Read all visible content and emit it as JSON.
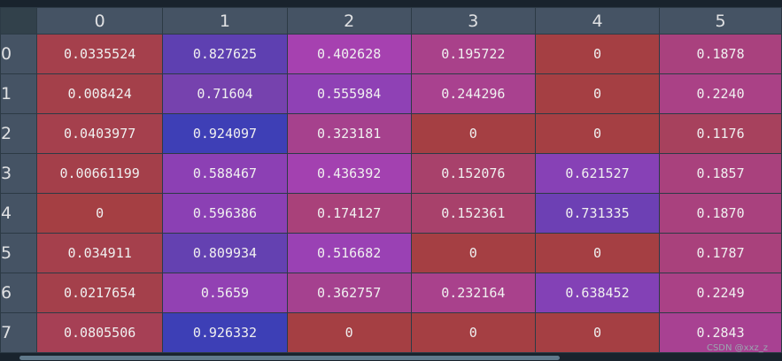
{
  "table": {
    "columns": [
      "0",
      "1",
      "2",
      "3",
      "4",
      "5"
    ],
    "rows": [
      {
        "index": "0",
        "cells": [
          {
            "text": "0.0335524",
            "color": "#a5404c"
          },
          {
            "text": "0.827625",
            "color": "#5e40b1"
          },
          {
            "text": "0.402628",
            "color": "#a641b0"
          },
          {
            "text": "0.195722",
            "color": "#a9418a"
          },
          {
            "text": "0",
            "color": "#a53f43"
          },
          {
            "text": "0.1878",
            "color": "#a9417e"
          }
        ]
      },
      {
        "index": "1",
        "cells": [
          {
            "text": "0.008424",
            "color": "#a4404a"
          },
          {
            "text": "0.71604",
            "color": "#7642ae"
          },
          {
            "text": "0.555984",
            "color": "#8f41b5"
          },
          {
            "text": "0.244296",
            "color": "#a9418f"
          },
          {
            "text": "0",
            "color": "#a53f43"
          },
          {
            "text": "0.2240",
            "color": "#aa4186"
          }
        ]
      },
      {
        "index": "2",
        "cells": [
          {
            "text": "0.0403977",
            "color": "#a5404d"
          },
          {
            "text": "0.924097",
            "color": "#3e3fb6"
          },
          {
            "text": "0.323181",
            "color": "#a6418d"
          },
          {
            "text": "0",
            "color": "#a53f43"
          },
          {
            "text": "0",
            "color": "#a53f43"
          },
          {
            "text": "0.1176",
            "color": "#a7415d"
          }
        ]
      },
      {
        "index": "3",
        "cells": [
          {
            "text": "0.00661199",
            "color": "#a43f4a"
          },
          {
            "text": "0.588467",
            "color": "#8c40b4"
          },
          {
            "text": "0.436392",
            "color": "#a341b0"
          },
          {
            "text": "0.152076",
            "color": "#a8416b"
          },
          {
            "text": "0.621527",
            "color": "#8741b6"
          },
          {
            "text": "0.1857",
            "color": "#a9417d"
          }
        ]
      },
      {
        "index": "4",
        "cells": [
          {
            "text": "0",
            "color": "#a53f43"
          },
          {
            "text": "0.596386",
            "color": "#8b40b4"
          },
          {
            "text": "0.174127",
            "color": "#a9417a"
          },
          {
            "text": "0.152361",
            "color": "#a8416b"
          },
          {
            "text": "0.731335",
            "color": "#6d40b4"
          },
          {
            "text": "0.1870",
            "color": "#a9417e"
          }
        ]
      },
      {
        "index": "5",
        "cells": [
          {
            "text": "0.034911",
            "color": "#a5404c"
          },
          {
            "text": "0.809934",
            "color": "#6441b1"
          },
          {
            "text": "0.516682",
            "color": "#9a41b4"
          },
          {
            "text": "0",
            "color": "#a53f43"
          },
          {
            "text": "0",
            "color": "#a53f43"
          },
          {
            "text": "0.1787",
            "color": "#a9417c"
          }
        ]
      },
      {
        "index": "6",
        "cells": [
          {
            "text": "0.0217654",
            "color": "#a4404b"
          },
          {
            "text": "0.5659",
            "color": "#9241b3"
          },
          {
            "text": "0.362757",
            "color": "#a5418f"
          },
          {
            "text": "0.232164",
            "color": "#a9418c"
          },
          {
            "text": "0.638452",
            "color": "#8341b6"
          },
          {
            "text": "0.2249",
            "color": "#aa4186"
          }
        ]
      },
      {
        "index": "7",
        "cells": [
          {
            "text": "0.0805506",
            "color": "#a64055"
          },
          {
            "text": "0.926332",
            "color": "#3d3fb6"
          },
          {
            "text": "0",
            "color": "#a53f43"
          },
          {
            "text": "0",
            "color": "#a53f43"
          },
          {
            "text": "0",
            "color": "#a53f43"
          },
          {
            "text": "0.2843",
            "color": "#a84192"
          }
        ]
      }
    ]
  },
  "watermark": "CSDN @xxz_z",
  "colors": {
    "background": "#19232d",
    "header_background": "#455364",
    "header_text": "#e0e1e3",
    "cell_text": "#f0f0f0"
  }
}
